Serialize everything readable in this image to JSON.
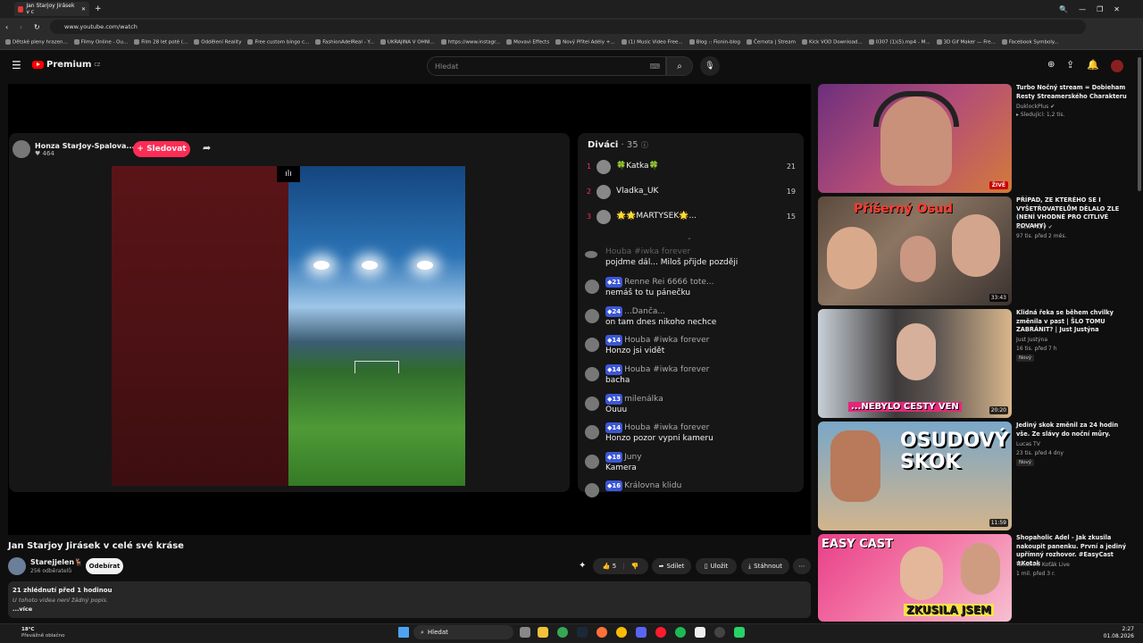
{
  "browser": {
    "tab_title": "Jan Starjoy Jirásek v c",
    "url": "www.youtube.com/watch",
    "bookmarks": [
      "Dětské pleny hrazen...",
      "Filmy Online - Ou...",
      "Film 28 let poté (...",
      "Oddělení Reality",
      "Free custom bingo c...",
      "FashionAdelReal - Y...",
      "UKRAJINA V OHNI...",
      "https://www.instagr...",
      "Movavi Effects",
      "Nový Přítel Adély +...",
      "(1) Music Video Free...",
      "Blog :: Fionin-blog",
      "Černota | Stream",
      "Kick VOD Download...",
      "0307 (1)(5).mp4 - M...",
      "3D Gif Maker — Fre...",
      "Facebook Symboly..."
    ]
  },
  "header": {
    "logo": "Premium",
    "region": "CZ",
    "search_placeholder": "Hledat"
  },
  "live": {
    "streamer_name": "Honza StarJoy-Spalova...",
    "likes": "464",
    "follow_label": "+ Sledovat"
  },
  "chat": {
    "title": "Diváci",
    "count": "· 35",
    "top": [
      {
        "rank": "1",
        "name": "🍀Katka🍀",
        "score": "21"
      },
      {
        "rank": "2",
        "name": "Vladka_UK",
        "score": "19"
      },
      {
        "rank": "3",
        "name": "🌟🌟MARTYSEK🌟...",
        "score": "15"
      }
    ],
    "partial": {
      "head": "Houba #iwka forever",
      "text": "pojdme dál... Miloš přijde později"
    },
    "messages": [
      {
        "badge": "21",
        "head": "Renne Rei 6666 tote...",
        "text": "nemáš to tu pánečku"
      },
      {
        "badge": "24",
        "head": "...Danča...",
        "text": "on tam dnes nikoho nechce"
      },
      {
        "badge": "14",
        "head": "Houba #iwka forever",
        "text": "Honzo jsi vidět"
      },
      {
        "badge": "14",
        "head": "Houba #iwka forever",
        "text": "bacha"
      },
      {
        "badge": "13",
        "head": "milenálka",
        "text": "Ouuu"
      },
      {
        "badge": "14",
        "head": "Houba #iwka forever",
        "text": "Honzo pozor vypni kameru"
      },
      {
        "badge": "18",
        "head": "Juny",
        "text": "Kamera"
      },
      {
        "badge": "16",
        "head": "Královna klidu",
        "text": ""
      }
    ]
  },
  "video": {
    "title": "Jan Starjoy Jirásek v celé své kráse",
    "channel": "Starejjelen🦌",
    "subscribers": "256 odběratelů",
    "subscribe_label": "Odebírat",
    "likes": "5",
    "share_label": "Sdílet",
    "save_label": "Uložit",
    "download_label": "Stáhnout",
    "meta": "21 zhlédnutí  před 1 hodinou",
    "no_description": "U tohoto videa není žádný popis.",
    "more": "...více"
  },
  "recommendations": [
    {
      "title": "Turbo Nočný stream = Dobieham Resty Streamerského Charakteru",
      "channel": "DuklockPlus ✔",
      "meta": "▸ Sledující: 1,2 tis.",
      "badge": "",
      "duration": "ŽIVĚ",
      "thumb_text": ""
    },
    {
      "title": "PŘÍPAD, ZE KTERÉHO SE I VYŠETŘOVATELŮM DĚLALO ZLE (NENÍ VHODNÉ PRO CITLIVÉ POVAHY)",
      "channel": "Noční Můry ✔",
      "meta": "97 tis. před 2 měs.",
      "badge": "",
      "duration": "33:43",
      "thumb_text": "Příšerný Osud"
    },
    {
      "title": "Klidná řeka se během chvilky změnila v past | ŠLO TOMU ZABRÁNIT? | Just Justýna",
      "channel": "Just Justýna",
      "meta": "16 tis.  před 7 h",
      "badge": "Nový",
      "duration": "20:20",
      "thumb_text": "...NEBYLO CESTY VEN"
    },
    {
      "title": "Jediný skok změnil za 24 hodin vše. Ze slávy do noční můry.",
      "channel": "Lucas TV",
      "meta": "23 tis.  před 4 dny",
      "badge": "Nový",
      "duration": "11:59",
      "thumb_text": "OSUDOVÝ SKOK"
    },
    {
      "title": "Shopaholic Adel - Jak zkusila nakoupit panenku. První a jediný upřímný rozhovor. #EasyCast #Kotak",
      "channel": "Talkshow Koťák Live",
      "meta": "1 mil.  před 3 r.",
      "badge": "",
      "duration": "",
      "thumb_text": "ZKUSILA JSEM"
    }
  ],
  "taskbar": {
    "temp": "18°C",
    "weather": "Převážně oblačno",
    "search": "Hledat",
    "time": "2:27",
    "date": "01.08.2026"
  }
}
